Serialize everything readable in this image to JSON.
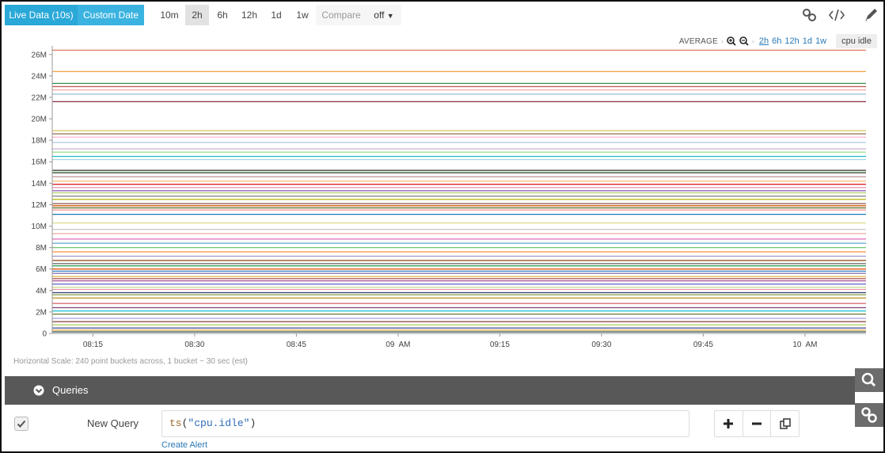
{
  "toolbar": {
    "live_label": "Live Data  (10s)",
    "custom_label": "Custom Date",
    "ranges": [
      "10m",
      "2h",
      "6h",
      "12h",
      "1d",
      "1w"
    ],
    "selected_range": "2h",
    "compare_label": "Compare",
    "compare_value": "off",
    "icons": [
      "link-icon",
      "code-icon",
      "pencil-icon"
    ]
  },
  "chart_controls": {
    "aggregation": "AVERAGE",
    "zoom_in_icon": "zoom-in-icon",
    "zoom_out_icon": "zoom-out-icon",
    "ranges": [
      "2h",
      "6h",
      "12h",
      "1d",
      "1w"
    ],
    "selected_range": "2h",
    "metric_badge": "cpu idle"
  },
  "chart_data": {
    "type": "line",
    "title": "",
    "xlabel": "",
    "ylabel": "",
    "x_ticks": [
      "08:15",
      "08:30",
      "08:45",
      "09  AM",
      "09:15",
      "09:30",
      "09:45",
      "10  AM"
    ],
    "x_tick_minutes": [
      15,
      30,
      45,
      60,
      75,
      90,
      105,
      120
    ],
    "x_range_minutes": [
      9,
      129
    ],
    "y_ticks": [
      "0",
      "2M",
      "4M",
      "6M",
      "8M",
      "10M",
      "12M",
      "14M",
      "16M",
      "18M",
      "20M",
      "22M",
      "24M",
      "26M"
    ],
    "ylim": [
      0,
      26500000
    ],
    "grid": false,
    "legend": "none",
    "series_note": "many flat lines, one per host, each roughly constant over the window",
    "series_values": [
      26400000,
      24400000,
      23300000,
      23000000,
      22700000,
      22300000,
      21600000,
      18900000,
      18600000,
      18300000,
      17800000,
      17200000,
      16900000,
      16500000,
      16200000,
      15200000,
      15000000,
      14900000,
      14600000,
      14200000,
      13900000,
      13600000,
      13300000,
      13100000,
      12800000,
      12500000,
      12100000,
      11900000,
      11700000,
      11500000,
      11100000,
      10300000,
      9700000,
      9300000,
      8800000,
      8400000,
      8000000,
      7600000,
      7200000,
      6800000,
      6500000,
      6300000,
      6000000,
      5800000,
      5600000,
      5300000,
      5100000,
      4900000,
      4600000,
      4300000,
      4100000,
      3800000,
      3600000,
      3300000,
      2800000,
      2400000,
      2100000,
      1800000,
      1400000,
      1100000,
      800000,
      500000,
      300000,
      150000
    ],
    "series_colors": [
      "#e07a5f",
      "#f2a541",
      "#3a8d4f",
      "#c0504d",
      "#f4a6a6",
      "#9bbad6",
      "#8b2e3c",
      "#d9c45b",
      "#8c6d4f",
      "#f7b6d2",
      "#aec7e8",
      "#c5b0d5",
      "#98df8a",
      "#17becf",
      "#9edae5",
      "#2c2c2c",
      "#3b7a3b",
      "#e4c1d9",
      "#c49c94",
      "#ffbb78",
      "#d62728",
      "#e89bb8",
      "#9467bd",
      "#b5cf6b",
      "#7f7f7f",
      "#bcbd22",
      "#8c564b",
      "#d35400",
      "#556b2f",
      "#ff9896",
      "#1f77b4",
      "#dbdb8d",
      "#c7c7c7",
      "#f1a9a0",
      "#e377c2",
      "#6baed6",
      "#74c476",
      "#fd8d3c",
      "#9e9ac8",
      "#8b4513",
      "#636363",
      "#31a354",
      "#e6550d",
      "#3182bd",
      "#756bb1",
      "#e7ba52",
      "#ad494a",
      "#a55194",
      "#6b6ecf",
      "#cedb9c",
      "#e7969c",
      "#393b79",
      "#8ca252",
      "#bd9e39",
      "#d6616b",
      "#7b4173",
      "#17becf",
      "#637939",
      "#9c9ede",
      "#843c39",
      "#b5cf6b",
      "#5254a3",
      "#e6a53e",
      "#2f4f4f"
    ]
  },
  "horizontal_scale": "Horizontal Scale: 240 point buckets across, 1 bucket ~ 30 sec (est)",
  "queries": {
    "header": "Queries",
    "items": [
      {
        "enabled": true,
        "name": "New Query",
        "expression": "ts(\"cpu.idle\")",
        "fn": "ts",
        "arg": "\"cpu.idle\"",
        "create_alert": "Create Alert"
      }
    ],
    "side_icons": [
      "search-icon",
      "link-icon"
    ],
    "action_icons": [
      "plus-icon",
      "minus-icon",
      "copy-icon"
    ]
  }
}
